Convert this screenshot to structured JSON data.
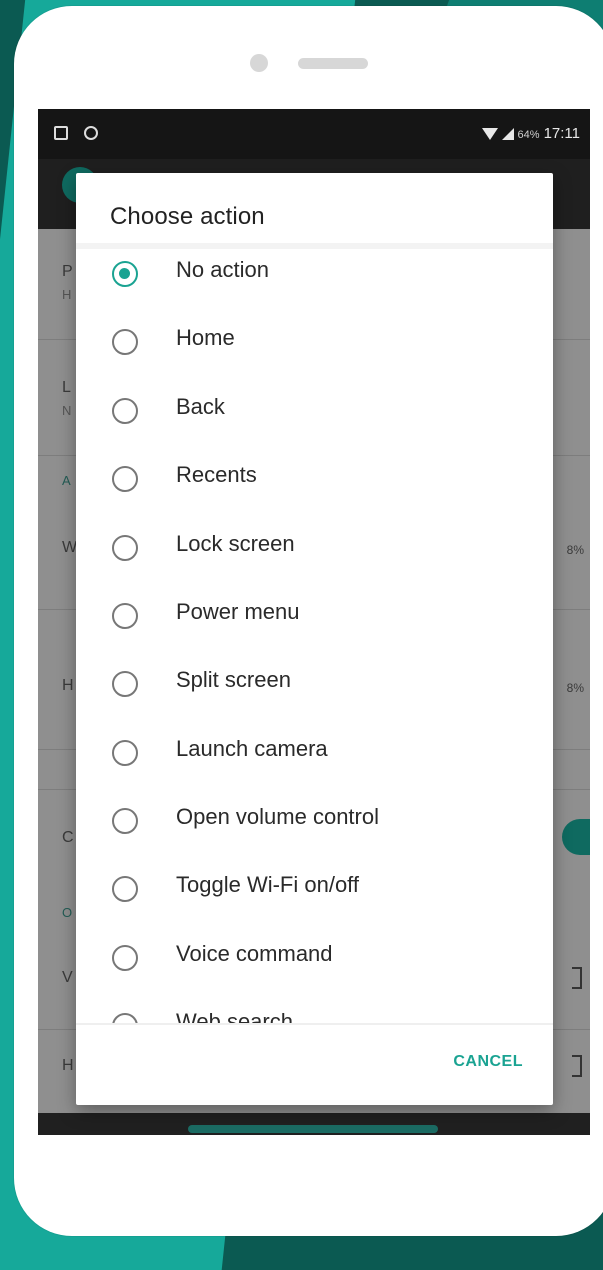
{
  "status_bar": {
    "battery_text": "64%",
    "time": "17:11"
  },
  "dialog": {
    "title": "Choose action",
    "selected_index": 0,
    "options": [
      {
        "label": "No action",
        "checked": true
      },
      {
        "label": "Home",
        "checked": false
      },
      {
        "label": "Back",
        "checked": false
      },
      {
        "label": "Recents",
        "checked": false
      },
      {
        "label": "Lock screen",
        "checked": false
      },
      {
        "label": "Power menu",
        "checked": false
      },
      {
        "label": "Split screen",
        "checked": false
      },
      {
        "label": "Launch camera",
        "checked": false
      },
      {
        "label": "Open volume control",
        "checked": false
      },
      {
        "label": "Toggle Wi-Fi on/off",
        "checked": false
      },
      {
        "label": "Voice command",
        "checked": false
      },
      {
        "label": "Web search",
        "checked": false
      }
    ],
    "cancel_label": "CANCEL"
  },
  "background_list": {
    "row_letters": [
      "P",
      "L",
      "A",
      "W",
      "H",
      "C",
      "O",
      "V",
      "H"
    ],
    "row_subs": [
      "H",
      "N"
    ],
    "right_values": [
      "8%",
      "8%"
    ]
  },
  "colors": {
    "accent": "#1aa392",
    "brand_dark": "#0b5a52"
  }
}
